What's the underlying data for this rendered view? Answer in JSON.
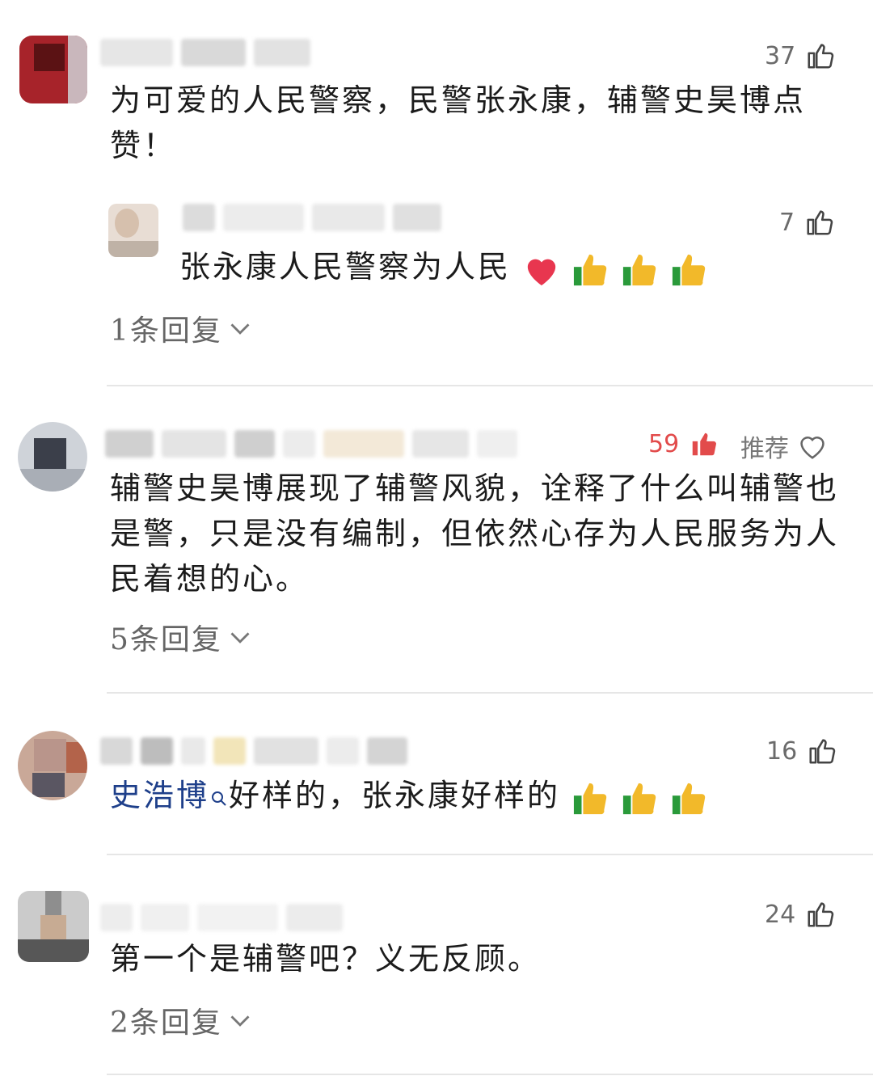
{
  "comments": [
    {
      "text": "为可爱的人民警察，民警张永康，辅警史昊博点赞！",
      "likes": "37",
      "reply": {
        "text": "张永康人民警察为人民",
        "likes": "7"
      },
      "replies_label": "1条回复"
    },
    {
      "text": "辅警史昊博展现了辅警风貌，诠释了什么叫辅警也是警，只是没有编制，但依然心存为人民服务为人民着想的心。",
      "likes": "59",
      "recommend_label": "推荐",
      "replies_label": "5条回复"
    },
    {
      "mention": "史浩博",
      "text": "好样的，张永康好样的",
      "likes": "16"
    },
    {
      "text": "第一个是辅警吧？义无反顾。",
      "likes": "24",
      "replies_label": "2条回复"
    }
  ],
  "colors": {
    "liked": "#e24b4b",
    "mention": "#1e3f8a"
  }
}
